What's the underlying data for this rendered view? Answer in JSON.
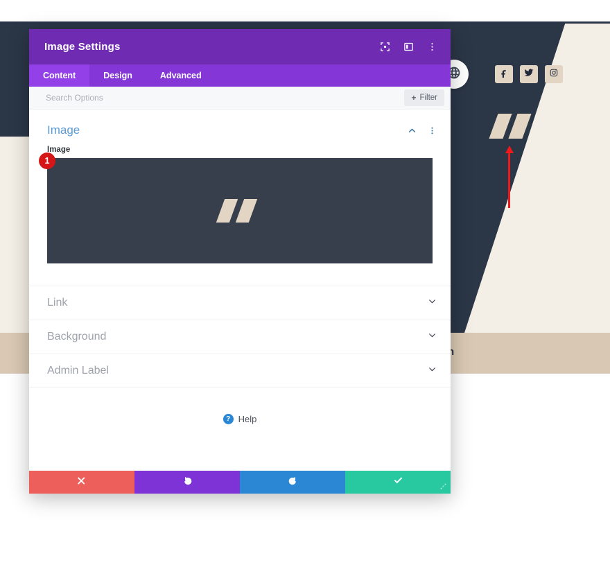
{
  "background": {
    "band_text": "n",
    "social": [
      {
        "name": "facebook-icon",
        "label": "Facebook"
      },
      {
        "name": "twitter-icon",
        "label": "Twitter"
      },
      {
        "name": "instagram-icon",
        "label": "Instagram"
      }
    ],
    "globe_label": "Language",
    "colors": {
      "hero": "#2b3647",
      "cream": "#f4efe6",
      "tan": "#d9c8b4",
      "accent_arrow": "#f01818"
    }
  },
  "modal": {
    "title": "Image Settings",
    "header_icons": [
      {
        "name": "fullscreen-icon",
        "label": "Fullscreen"
      },
      {
        "name": "split-view-icon",
        "label": "Split view"
      },
      {
        "name": "more-options-icon",
        "label": "More options"
      }
    ],
    "tabs": [
      {
        "label": "Content",
        "active": true
      },
      {
        "label": "Design",
        "active": false
      },
      {
        "label": "Advanced",
        "active": false
      }
    ],
    "search": {
      "value": "",
      "placeholder": "Search Options"
    },
    "filter": {
      "label": "Filter",
      "plus": "+"
    },
    "section": {
      "title": "Image",
      "collapse_label": "Collapse",
      "more_label": "More options"
    },
    "image_field": {
      "label": "Image",
      "step_badge": "1",
      "preview_alt": "quote-mark-image"
    },
    "accordion": [
      {
        "label": "Link"
      },
      {
        "label": "Background"
      },
      {
        "label": "Admin Label"
      }
    ],
    "help": {
      "icon_char": "?",
      "label": "Help"
    },
    "footer": [
      {
        "name": "cancel-button",
        "label": "Cancel",
        "color": "#ec5f5b"
      },
      {
        "name": "undo-button",
        "label": "Undo",
        "color": "#7d33d6"
      },
      {
        "name": "redo-button",
        "label": "Redo",
        "color": "#2b87d3"
      },
      {
        "name": "save-button",
        "label": "Save",
        "color": "#28c9a0"
      }
    ],
    "resize_label": "Resize"
  }
}
